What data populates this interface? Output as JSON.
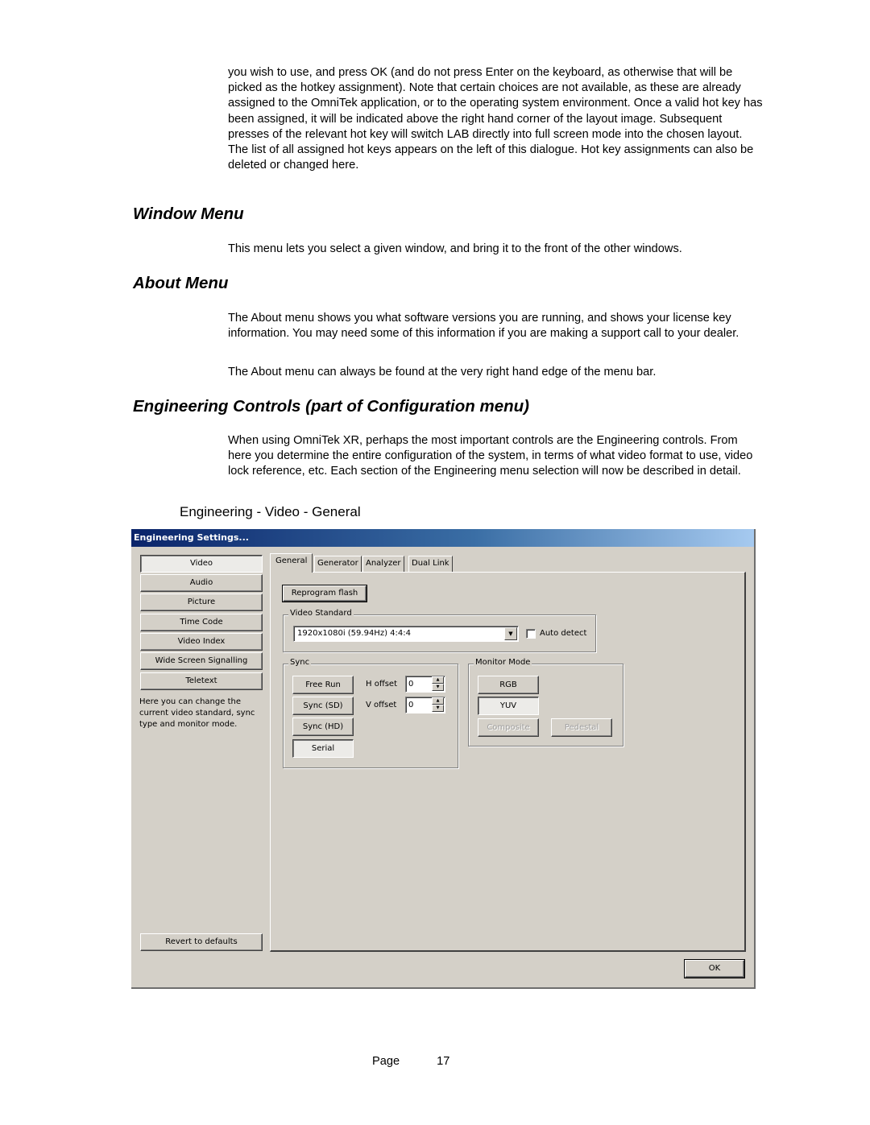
{
  "document": {
    "intro_paragraph": "you wish to use, and press OK (and do not press Enter on the keyboard, as otherwise that will be picked as the hotkey assignment).  Note that certain choices are not available, as these are already assigned to the OmniTek application, or to the operating system environment.  Once a valid hot key has been assigned, it will be indicated above the right hand corner of the layout image.   Subsequent presses of the relevant hot key will switch LAB directly into full screen mode into the chosen layout.  The list of all assigned hot keys appears on the left of this dialogue.  Hot key assignments can also be deleted or changed here.",
    "sections": [
      {
        "heading": "Window Menu",
        "paragraphs": [
          "This menu lets you select a given window, and bring it to the front of the other windows."
        ]
      },
      {
        "heading": "About Menu",
        "paragraphs": [
          "The About menu shows you what software versions you are running, and shows your license key information. You may need some of this information if you are making a support call to your dealer.",
          "The About menu can always be found at the very right hand edge of the menu bar."
        ]
      },
      {
        "heading": "Engineering Controls (part of Configuration menu)",
        "paragraphs": [
          "When using OmniTek XR, perhaps the most important controls are the Engineering controls.  From here you determine the entire configuration of the system, in terms of what video format to use, video lock reference, etc.  Each section of the Engineering menu selection will now be described in detail."
        ]
      }
    ],
    "figure_caption": "Engineering - Video - General",
    "footer": {
      "page_label": "Page",
      "page_number": "17"
    }
  },
  "dialog": {
    "title": "Engineering Settings...",
    "sidebar": {
      "items": [
        {
          "label": "Video",
          "selected": true
        },
        {
          "label": "Audio",
          "selected": false
        },
        {
          "label": "Picture",
          "selected": false
        },
        {
          "label": "Time Code",
          "selected": false
        },
        {
          "label": "Video Index",
          "selected": false
        },
        {
          "label": "Wide Screen Signalling",
          "selected": false
        },
        {
          "label": "Teletext",
          "selected": false
        }
      ],
      "help_text": "Here you can change the current video standard, sync type and monitor mode.",
      "revert_label": "Revert to defaults"
    },
    "tabs": [
      {
        "label": "General",
        "active": true
      },
      {
        "label": "Generator",
        "active": false
      },
      {
        "label": "Analyzer",
        "active": false
      },
      {
        "label": "Dual Link",
        "active": false
      }
    ],
    "general": {
      "reprogram_label": "Reprogram flash",
      "video_standard": {
        "group_label": "Video Standard",
        "selected": "1920x1080i (59.94Hz) 4:4:4",
        "auto_detect_label": "Auto detect",
        "auto_detect_checked": false
      },
      "sync": {
        "group_label": "Sync",
        "buttons": [
          {
            "label": "Free Run",
            "pressed": false
          },
          {
            "label": "Sync (SD)",
            "pressed": false
          },
          {
            "label": "Sync (HD)",
            "pressed": false
          },
          {
            "label": "Serial",
            "pressed": true
          }
        ],
        "h_offset_label": "H offset",
        "h_offset_value": "0",
        "v_offset_label": "V offset",
        "v_offset_value": "0"
      },
      "monitor_mode": {
        "group_label": "Monitor Mode",
        "rgb_label": "RGB",
        "yuv_label": "YUV",
        "composite_label": "Composite",
        "pedestal_label": "Pedestal",
        "selected": "YUV"
      }
    },
    "ok_label": "OK"
  }
}
